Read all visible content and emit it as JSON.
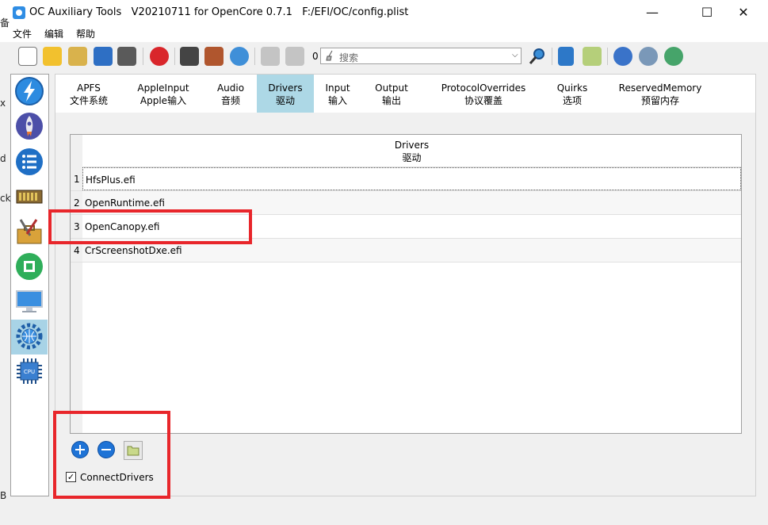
{
  "window": {
    "title": "OC Auxiliary Tools   V20210711 for OpenCore 0.7.1   F:/EFI/OC/config.plist",
    "minimize": "—",
    "maximize": "☐",
    "close": "✕"
  },
  "menu": [
    "文件",
    "编辑",
    "帮助"
  ],
  "toolbar": {
    "counter": "0",
    "search_placeholder": "搜索"
  },
  "tabs": [
    {
      "en": "APFS",
      "zh": "文件系统"
    },
    {
      "en": "AppleInput",
      "zh": "Apple输入"
    },
    {
      "en": "Audio",
      "zh": "音频"
    },
    {
      "en": "Drivers",
      "zh": "驱动"
    },
    {
      "en": "Input",
      "zh": "输入"
    },
    {
      "en": "Output",
      "zh": "输出"
    },
    {
      "en": "ProtocolOverrides",
      "zh": "协议覆盖"
    },
    {
      "en": "Quirks",
      "zh": "选项"
    },
    {
      "en": "ReservedMemory",
      "zh": "预留内存"
    }
  ],
  "table": {
    "header_en": "Drivers",
    "header_zh": "驱动",
    "rows": [
      {
        "num": "1",
        "value": "HfsPlus.efi"
      },
      {
        "num": "2",
        "value": "OpenRuntime.efi"
      },
      {
        "num": "3",
        "value": "OpenCanopy.efi"
      },
      {
        "num": "4",
        "value": "CrScreenshotDxe.efi"
      }
    ]
  },
  "bottom": {
    "checkbox_label": "ConnectDrivers",
    "checkbox_mark": "✓"
  },
  "edge_fragments": [
    "备",
    "d",
    "ck",
    "x",
    "B"
  ],
  "colors": {
    "accent_tab": "#add8e6",
    "highlight": "#e8262b",
    "button_blue": "#1e73d6"
  }
}
